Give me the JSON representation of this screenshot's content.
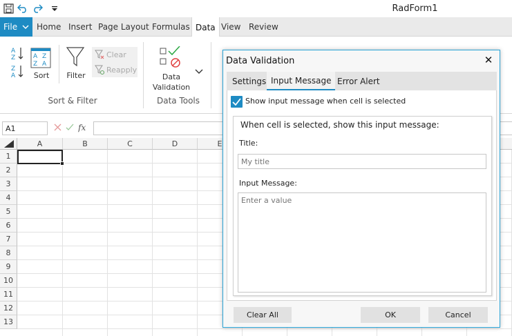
{
  "window": {
    "title": "RadForm1"
  },
  "quick_access": {
    "icons": [
      "save-icon",
      "undo-icon",
      "redo-icon",
      "customize-dropdown-icon"
    ]
  },
  "ribbon": {
    "file_label": "File",
    "tabs": [
      {
        "label": "Home"
      },
      {
        "label": "Insert"
      },
      {
        "label": "Page Layout"
      },
      {
        "label": "Formulas"
      },
      {
        "label": "Data",
        "active": true
      },
      {
        "label": "View"
      },
      {
        "label": "Review"
      }
    ],
    "sort_filter": {
      "sort_label": "Sort",
      "filter_label": "Filter",
      "clear_label": "Clear",
      "reapply_label": "Reapply",
      "group_label": "Sort & Filter"
    },
    "data_tools": {
      "validation_line1": "Data",
      "validation_line2": "Validation",
      "group_label": "Data Tools"
    }
  },
  "formula_bar": {
    "name_box": "A1",
    "formula": ""
  },
  "grid": {
    "columns": [
      "A",
      "B",
      "C",
      "D",
      "E"
    ],
    "rows": [
      "1",
      "2",
      "3",
      "4",
      "5",
      "6",
      "7",
      "8",
      "9",
      "10",
      "11",
      "12",
      "13"
    ],
    "selected_cell": "A1"
  },
  "dialog": {
    "title": "Data Validation",
    "tabs": [
      {
        "label": "Settings"
      },
      {
        "label": "Input Message",
        "active": true
      },
      {
        "label": "Error Alert"
      }
    ],
    "show_message_checked": true,
    "show_message_label": "Show input message when cell is selected",
    "section_heading": "When cell is selected, show this input message:",
    "title_label": "Title:",
    "title_placeholder": "My title",
    "message_label": "Input Message:",
    "message_placeholder": "Enter a value",
    "buttons": {
      "clear_all": "Clear All",
      "ok": "OK",
      "cancel": "Cancel"
    }
  },
  "colors": {
    "accent": "#1e8bc3",
    "dialog_border": "#29a3d6",
    "validation_check": "#2aa842",
    "validation_stop": "#e04040"
  }
}
